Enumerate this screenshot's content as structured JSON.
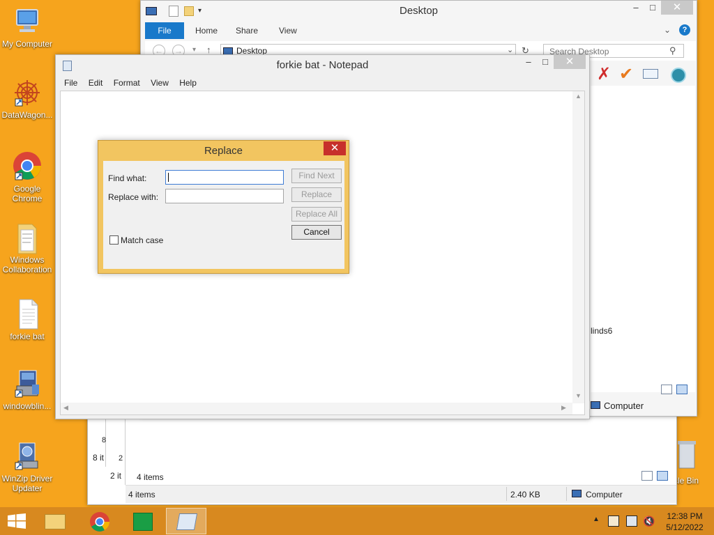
{
  "desktop": {
    "icons": [
      {
        "label1": "My Computer",
        "label2": "",
        "icon": "computer-icon"
      },
      {
        "label1": "DataWagon...",
        "label2": "",
        "icon": "datawagon-icon"
      },
      {
        "label1": "Google",
        "label2": "Chrome",
        "icon": "chrome-icon"
      },
      {
        "label1": "Windows",
        "label2": "Collaboration",
        "icon": "folder-icon"
      },
      {
        "label1": "forkie bat",
        "label2": "",
        "icon": "text-file-icon"
      },
      {
        "label1": "windowblin...",
        "label2": "",
        "icon": "installer-icon"
      },
      {
        "label1": "WinZip Driver",
        "label2": "Updater",
        "icon": "winzip-icon"
      }
    ],
    "recycle_label": "cle Bin"
  },
  "explorer": {
    "title": "Desktop",
    "tabs": {
      "file": "File",
      "home": "Home",
      "share": "Share",
      "view": "View"
    },
    "address": "Desktop",
    "search_placeholder": "Search Desktop",
    "partial_item": "linds6",
    "status_location": "Computer"
  },
  "explorer_back": {
    "items_count": "4 items",
    "status_items": "4 items",
    "size": "2.40 KB",
    "location": "Computer",
    "stub1": "8 it",
    "stub2": "2 it",
    "stub1_digit": "8",
    "stub2_digit": "2"
  },
  "notepad": {
    "title": "forkie bat - Notepad",
    "menu": [
      "File",
      "Edit",
      "Format",
      "View",
      "Help"
    ]
  },
  "replace_dialog": {
    "title": "Replace",
    "find_label": "Find what:",
    "replace_label": "Replace with:",
    "find_value": "",
    "replace_value": "",
    "find_next": "Find Next",
    "replace": "Replace",
    "replace_all": "Replace All",
    "cancel": "Cancel",
    "match_case": "Match case"
  },
  "taskbar": {
    "time": "12:38 PM",
    "date": "5/12/2022"
  },
  "colors": {
    "desktop": "#f6a41d",
    "taskbar": "#d8891f",
    "dialog_frame": "#f2c560",
    "close_red": "#c7302b",
    "file_tab": "#1979ca"
  }
}
